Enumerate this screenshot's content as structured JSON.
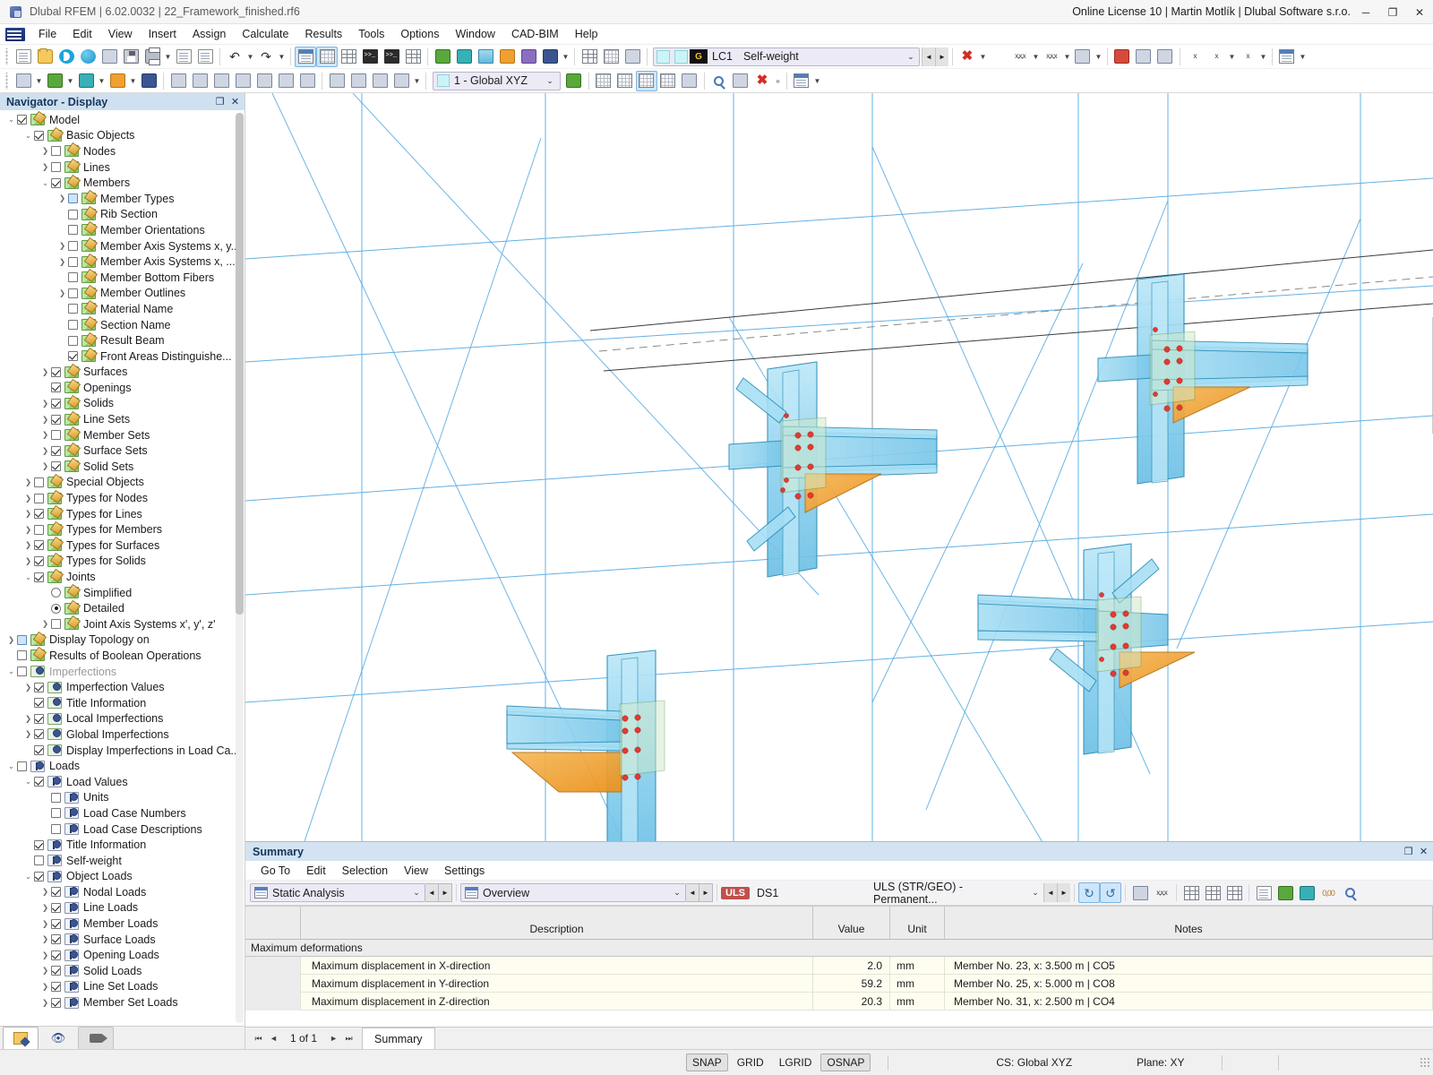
{
  "titlebar": {
    "title": "Dlubal RFEM | 6.02.0032 | 22_Framework_finished.rf6",
    "license": "Online License 10 | Martin Motlík | Dlubal Software s.r.o.",
    "minimize": "─",
    "maximize": "❐",
    "close": "✕"
  },
  "menubar": {
    "items": [
      "File",
      "Edit",
      "View",
      "Insert",
      "Assign",
      "Calculate",
      "Results",
      "Tools",
      "Options",
      "Window",
      "CAD-BIM",
      "Help"
    ]
  },
  "toolbar": {
    "load_case": {
      "number": "LC1",
      "name": "Self-weight",
      "category": "G"
    },
    "coord_system": {
      "label": "1 - Global XYZ"
    }
  },
  "navigator": {
    "title": "Navigator - Display",
    "restore": "❐",
    "close": "✕",
    "tabs": [
      "display-tab",
      "visibility-tab",
      "views-tab"
    ],
    "tree": [
      {
        "indent": 0,
        "exp": "v",
        "state": "checked",
        "icon": "ruler",
        "label": "Model"
      },
      {
        "indent": 1,
        "exp": "v",
        "state": "checked",
        "icon": "ruler",
        "label": "Basic Objects"
      },
      {
        "indent": 2,
        "exp": ">",
        "state": "unchecked",
        "icon": "ruler",
        "label": "Nodes"
      },
      {
        "indent": 2,
        "exp": ">",
        "state": "unchecked",
        "icon": "ruler",
        "label": "Lines"
      },
      {
        "indent": 2,
        "exp": "v",
        "state": "checked",
        "icon": "ruler",
        "label": "Members"
      },
      {
        "indent": 3,
        "exp": ">",
        "state": "partial",
        "icon": "ruler",
        "label": "Member Types"
      },
      {
        "indent": 3,
        "exp": "",
        "state": "unchecked",
        "icon": "ruler",
        "label": "Rib Section"
      },
      {
        "indent": 3,
        "exp": "",
        "state": "unchecked",
        "icon": "ruler",
        "label": "Member Orientations"
      },
      {
        "indent": 3,
        "exp": ">",
        "state": "unchecked",
        "icon": "ruler",
        "label": "Member Axis Systems x, y..."
      },
      {
        "indent": 3,
        "exp": ">",
        "state": "unchecked",
        "icon": "ruler",
        "label": "Member Axis Systems x, ..."
      },
      {
        "indent": 3,
        "exp": "",
        "state": "unchecked",
        "icon": "ruler",
        "label": "Member Bottom Fibers"
      },
      {
        "indent": 3,
        "exp": ">",
        "state": "unchecked",
        "icon": "ruler",
        "label": "Member Outlines"
      },
      {
        "indent": 3,
        "exp": "",
        "state": "unchecked",
        "icon": "ruler",
        "label": "Material Name"
      },
      {
        "indent": 3,
        "exp": "",
        "state": "unchecked",
        "icon": "ruler",
        "label": "Section Name"
      },
      {
        "indent": 3,
        "exp": "",
        "state": "unchecked",
        "icon": "ruler",
        "label": "Result Beam"
      },
      {
        "indent": 3,
        "exp": "",
        "state": "checked",
        "icon": "ruler",
        "label": "Front Areas Distinguishe..."
      },
      {
        "indent": 2,
        "exp": ">",
        "state": "checked",
        "icon": "ruler",
        "label": "Surfaces"
      },
      {
        "indent": 2,
        "exp": "",
        "state": "checked",
        "icon": "ruler",
        "label": "Openings"
      },
      {
        "indent": 2,
        "exp": ">",
        "state": "checked",
        "icon": "ruler",
        "label": "Solids"
      },
      {
        "indent": 2,
        "exp": ">",
        "state": "checked",
        "icon": "ruler",
        "label": "Line Sets"
      },
      {
        "indent": 2,
        "exp": ">",
        "state": "unchecked",
        "icon": "ruler",
        "label": "Member Sets"
      },
      {
        "indent": 2,
        "exp": ">",
        "state": "checked",
        "icon": "ruler",
        "label": "Surface Sets"
      },
      {
        "indent": 2,
        "exp": ">",
        "state": "checked",
        "icon": "ruler",
        "label": "Solid Sets"
      },
      {
        "indent": 1,
        "exp": ">",
        "state": "unchecked",
        "icon": "ruler",
        "label": "Special Objects"
      },
      {
        "indent": 1,
        "exp": ">",
        "state": "unchecked",
        "icon": "ruler",
        "label": "Types for Nodes"
      },
      {
        "indent": 1,
        "exp": ">",
        "state": "checked",
        "icon": "ruler",
        "label": "Types for Lines"
      },
      {
        "indent": 1,
        "exp": ">",
        "state": "unchecked",
        "icon": "ruler",
        "label": "Types for Members"
      },
      {
        "indent": 1,
        "exp": ">",
        "state": "checked",
        "icon": "ruler",
        "label": "Types for Surfaces"
      },
      {
        "indent": 1,
        "exp": ">",
        "state": "checked",
        "icon": "ruler",
        "label": "Types for Solids"
      },
      {
        "indent": 1,
        "exp": "v",
        "state": "checked",
        "icon": "ruler",
        "label": "Joints"
      },
      {
        "indent": 2,
        "exp": "",
        "state": "radio-off",
        "icon": "ruler",
        "label": "Simplified"
      },
      {
        "indent": 2,
        "exp": "",
        "state": "radio-on",
        "icon": "ruler",
        "label": "Detailed"
      },
      {
        "indent": 2,
        "exp": ">",
        "state": "unchecked",
        "icon": "ruler",
        "label": "Joint Axis Systems x', y', z'"
      },
      {
        "indent": 0,
        "exp": ">",
        "state": "partial",
        "icon": "ruler",
        "label": "Display Topology on"
      },
      {
        "indent": 0,
        "exp": "",
        "state": "unchecked",
        "icon": "ruler",
        "label": "Results of Boolean Operations"
      },
      {
        "indent": 0,
        "exp": "v",
        "state": "unchecked",
        "icon": "imp",
        "label": "Imperfections",
        "dim": true
      },
      {
        "indent": 1,
        "exp": ">",
        "state": "checked",
        "icon": "imp",
        "label": "Imperfection Values"
      },
      {
        "indent": 1,
        "exp": "",
        "state": "checked",
        "icon": "imp",
        "label": "Title Information"
      },
      {
        "indent": 1,
        "exp": ">",
        "state": "checked",
        "icon": "imp",
        "label": "Local Imperfections"
      },
      {
        "indent": 1,
        "exp": ">",
        "state": "checked",
        "icon": "imp",
        "label": "Global Imperfections"
      },
      {
        "indent": 1,
        "exp": "",
        "state": "checked",
        "icon": "imp",
        "label": "Display Imperfections in Load Ca..."
      },
      {
        "indent": 0,
        "exp": "v",
        "state": "unchecked",
        "icon": "load",
        "label": "Loads"
      },
      {
        "indent": 1,
        "exp": "v",
        "state": "checked",
        "icon": "load",
        "label": "Load Values"
      },
      {
        "indent": 2,
        "exp": "",
        "state": "unchecked",
        "icon": "load",
        "label": "Units"
      },
      {
        "indent": 2,
        "exp": "",
        "state": "unchecked",
        "icon": "load",
        "label": "Load Case Numbers"
      },
      {
        "indent": 2,
        "exp": "",
        "state": "unchecked",
        "icon": "load",
        "label": "Load Case Descriptions"
      },
      {
        "indent": 1,
        "exp": "",
        "state": "checked",
        "icon": "load",
        "label": "Title Information"
      },
      {
        "indent": 1,
        "exp": "",
        "state": "unchecked",
        "icon": "load",
        "label": "Self-weight"
      },
      {
        "indent": 1,
        "exp": "v",
        "state": "checked",
        "icon": "load",
        "label": "Object Loads"
      },
      {
        "indent": 2,
        "exp": ">",
        "state": "checked",
        "icon": "load",
        "label": "Nodal Loads"
      },
      {
        "indent": 2,
        "exp": ">",
        "state": "checked",
        "icon": "load",
        "label": "Line Loads"
      },
      {
        "indent": 2,
        "exp": ">",
        "state": "checked",
        "icon": "load",
        "label": "Member Loads"
      },
      {
        "indent": 2,
        "exp": ">",
        "state": "checked",
        "icon": "load",
        "label": "Surface Loads"
      },
      {
        "indent": 2,
        "exp": ">",
        "state": "checked",
        "icon": "load",
        "label": "Opening Loads"
      },
      {
        "indent": 2,
        "exp": ">",
        "state": "checked",
        "icon": "load",
        "label": "Solid Loads"
      },
      {
        "indent": 2,
        "exp": ">",
        "state": "checked",
        "icon": "load",
        "label": "Line Set Loads"
      },
      {
        "indent": 2,
        "exp": ">",
        "state": "checked",
        "icon": "load",
        "label": "Member Set Loads"
      }
    ]
  },
  "summary": {
    "title": "Summary",
    "restore": "❐",
    "close": "✕",
    "menu": [
      "Go To",
      "Edit",
      "Selection",
      "View",
      "Settings"
    ],
    "analysis_select": "Static Analysis",
    "view_select": "Overview",
    "design_situation_badge": "ULS",
    "design_situation_id": "DS1",
    "design_situation_name": "ULS (STR/GEO) - Permanent...",
    "columns": [
      "",
      "Description",
      "Value",
      "Unit",
      "Notes"
    ],
    "group_label": "Maximum deformations",
    "rows": [
      {
        "description": "Maximum displacement in X-direction",
        "value": "2.0",
        "unit": "mm",
        "notes": "Member No. 23, x: 3.500 m | CO5"
      },
      {
        "description": "Maximum displacement in Y-direction",
        "value": "59.2",
        "unit": "mm",
        "notes": "Member No. 25, x: 5.000 m | CO8"
      },
      {
        "description": "Maximum displacement in Z-direction",
        "value": "20.3",
        "unit": "mm",
        "notes": "Member No. 31, x: 2.500 m | CO4"
      }
    ],
    "page_indicator": "1 of 1",
    "first": "⏮",
    "prev": "◄",
    "next": "►",
    "last": "⏭",
    "tab": "Summary"
  },
  "statusbar": {
    "snap": "SNAP",
    "grid": "GRID",
    "lgrid": "LGRID",
    "osnap": "OSNAP",
    "cs": "CS: Global XYZ",
    "plane": "Plane: XY"
  },
  "colors": {
    "accent": "#3a5590",
    "steel": "#9fd9f0",
    "haunch": "#f0a030",
    "bolt": "#e03b2f",
    "grid_line": "#4aa3df",
    "uls": "#c0504d"
  }
}
